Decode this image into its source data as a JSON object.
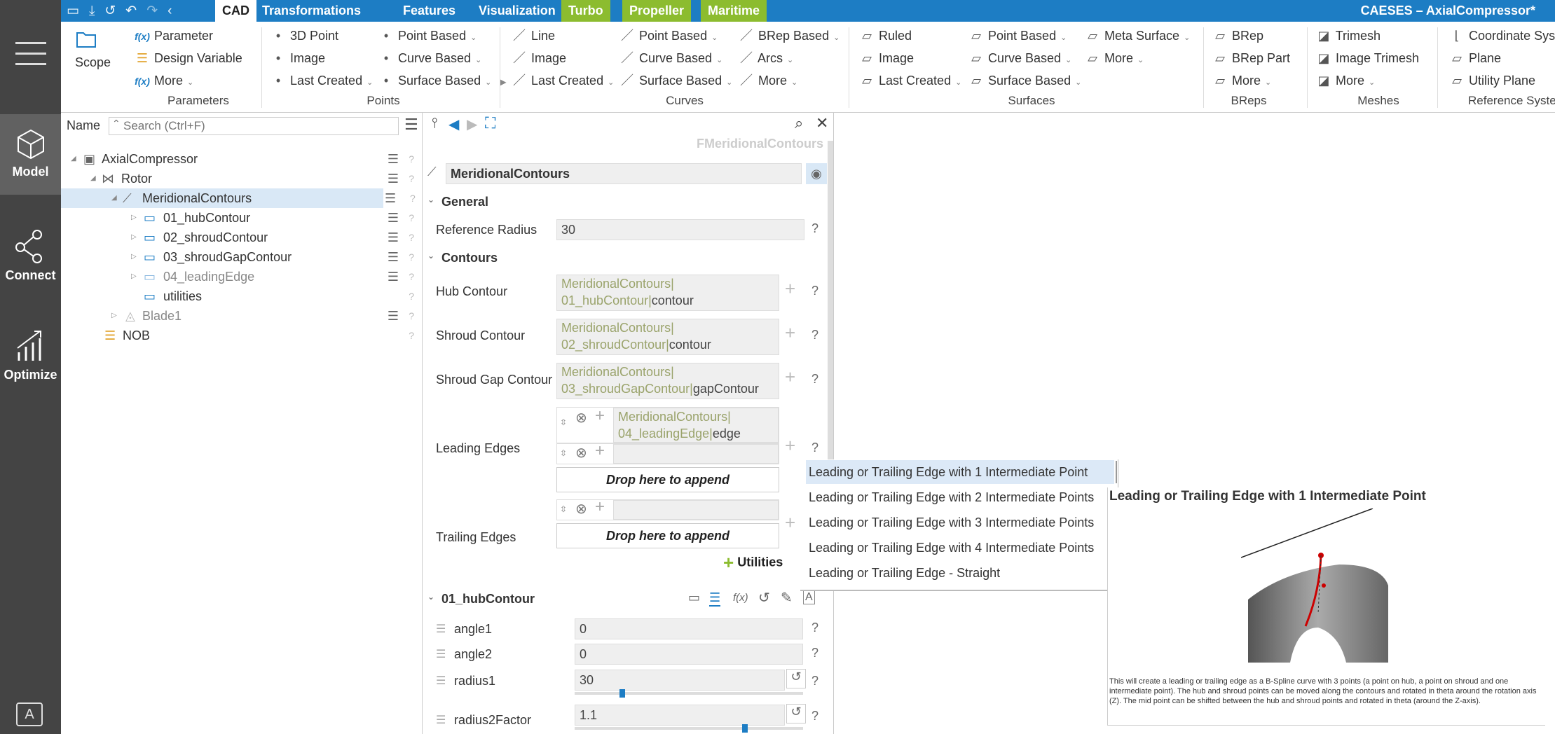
{
  "window_title": "CAESES – AxialCompressor*",
  "tabs": [
    {
      "label": "CAD"
    },
    {
      "label": "Transformations"
    },
    {
      "label": "Features"
    },
    {
      "label": "Visualization"
    },
    {
      "label": "Turbo"
    },
    {
      "label": "Propeller"
    },
    {
      "label": "Maritime"
    }
  ],
  "nav": {
    "model": "Model",
    "connect": "Connect",
    "optimize": "Optimize",
    "logo": "A"
  },
  "ribbon": {
    "scope": "Scope",
    "parameters": {
      "parameter": "Parameter",
      "design_variable": "Design Variable",
      "more": "More",
      "group": "Parameters"
    },
    "points": {
      "p3d": "3D Point",
      "image": "Image",
      "last_created": "Last Created",
      "point_based": "Point Based",
      "curve_based": "Curve Based",
      "surface_based": "Surface Based",
      "group": "Points"
    },
    "curves": {
      "line": "Line",
      "image": "Image",
      "last_created": "Last Created",
      "point_based": "Point Based",
      "curve_based": "Curve Based",
      "surface_based": "Surface Based",
      "brep_based": "BRep Based",
      "arcs": "Arcs",
      "more": "More",
      "group": "Curves"
    },
    "surfaces": {
      "ruled": "Ruled",
      "image": "Image",
      "last_created": "Last Created",
      "point_based": "Point Based",
      "curve_based": "Curve Based",
      "surface_based": "Surface Based",
      "meta_surface": "Meta Surface",
      "more": "More",
      "group": "Surfaces"
    },
    "breps": {
      "brep": "BRep",
      "brep_part": "BRep Part",
      "more": "More",
      "group": "BReps"
    },
    "meshes": {
      "trimesh": "Trimesh",
      "image_trimesh": "Image Trimesh",
      "more": "More",
      "group": "Meshes"
    },
    "refsys": {
      "coord": "Coordinate Sys",
      "plane": "Plane",
      "utility_plane": "Utility Plane",
      "group": "Reference Syste"
    }
  },
  "tree": {
    "name_label": "Name",
    "search_placeholder": "Search (Ctrl+F)",
    "items": [
      {
        "label": "AxialCompressor"
      },
      {
        "label": "Rotor"
      },
      {
        "label": "MeridionalContours"
      },
      {
        "label": "01_hubContour"
      },
      {
        "label": "02_shroudContour"
      },
      {
        "label": "03_shroudGapContour"
      },
      {
        "label": "04_leadingEdge"
      },
      {
        "label": "utilities"
      },
      {
        "label": "Blade1"
      },
      {
        "label": "NOB"
      }
    ]
  },
  "props": {
    "type_label": "FMeridionalContours",
    "name_value": "MeridionalContours",
    "general": "General",
    "ref_radius_label": "Reference Radius",
    "ref_radius_value": "30",
    "contours": "Contours",
    "hub_label": "Hub Contour",
    "hub_ref1": "MeridionalContours|",
    "hub_ref2": "01_hubContour|",
    "hub_ref3": "contour",
    "shroud_label": "Shroud Contour",
    "shroud_ref1": "MeridionalContours|",
    "shroud_ref2": "02_shroudContour|",
    "shroud_ref3": "contour",
    "gap_label": "Shroud Gap Contour",
    "gap_ref1": "MeridionalContours|",
    "gap_ref2": "03_shroudGapContour|",
    "gap_ref3": "gapContour",
    "le_label": "Leading Edges",
    "le_ref1": "MeridionalContours|",
    "le_ref2": "04_leadingEdge|",
    "le_ref3": "edge",
    "drop_append": "Drop here to append",
    "te_label": "Trailing Edges",
    "utilities": "Utilities",
    "hub_section": "01_hubContour",
    "angle1_label": "angle1",
    "angle1_value": "0",
    "angle2_label": "angle2",
    "angle2_value": "0",
    "radius1_label": "radius1",
    "radius1_value": "30",
    "radius1_slider": 0.2,
    "radius2f_label": "radius2Factor",
    "radius2f_value": "1.1",
    "radius2f_slider": 0.75
  },
  "menu": {
    "items": [
      {
        "label": "Leading or Trailing Edge with 1 Intermediate Point"
      },
      {
        "label": "Leading or Trailing Edge with 2 Intermediate Points"
      },
      {
        "label": "Leading or Trailing Edge with 3 Intermediate Points"
      },
      {
        "label": "Leading or Trailing Edge with 4 Intermediate Points"
      },
      {
        "label": "Leading or Trailing Edge - Straight"
      }
    ]
  },
  "tooltip": {
    "title": "Leading or Trailing Edge with 1 Intermediate Point",
    "desc": "This will create a leading or trailing edge as a B-Spline curve with 3 points (a point on hub, a point on shroud and one intermediate point). The hub and shroud points can be moved along the contours and rotated in theta around the rotation axis (Z). The mid point can be shifted between the hub and shroud points and rotated in theta (around the Z-axis)."
  },
  "colors": {
    "topbar": "#1d7dc4",
    "green_tab": "#8cbc2f",
    "nav": "#444444",
    "selection": "#d9e8f6"
  }
}
